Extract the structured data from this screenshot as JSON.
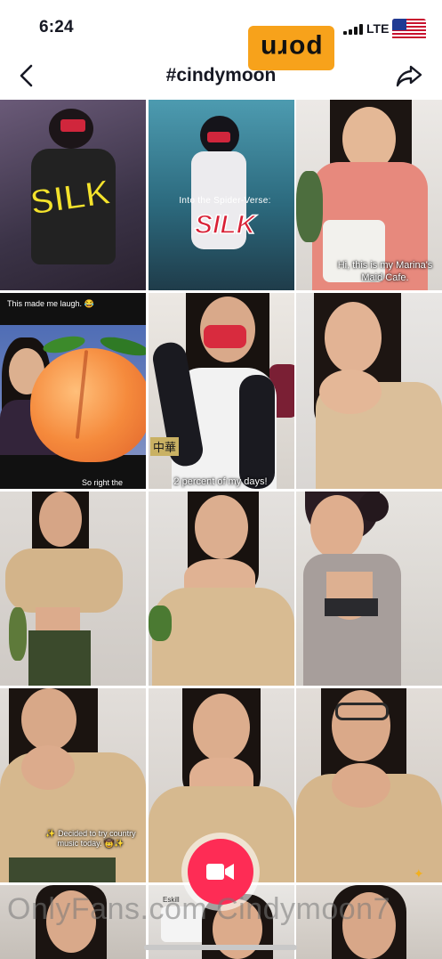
{
  "status_bar": {
    "time": "6:24",
    "network": "LTE"
  },
  "watermark_logo": "porn",
  "header": {
    "title": "#cindymoon"
  },
  "tiles": {
    "t1": {
      "text": "SILK"
    },
    "t2": {
      "text": "Into the Spider-Verse:",
      "logo": "SILK"
    },
    "t3": {
      "caption": "Hi, this is my Marina's Maid Cafe."
    },
    "t4": {
      "top": "This made me laugh. 😂",
      "bottom": "So right the"
    },
    "t5": {
      "caption": "2 percent of my days!",
      "sign": "中華"
    },
    "t11": {
      "caption": "✨ Decided to try country music today. 🤠✨"
    },
    "t16": {
      "text": "Eskill"
    }
  },
  "watermark_text": "OnlyFans.com Cindymoon7",
  "colors": {
    "accent": "#fe2c55",
    "logo_bg": "#f7a21b"
  },
  "icons": {
    "back": "chevron-left-icon",
    "share": "share-arrow-icon",
    "record": "video-camera-icon"
  }
}
